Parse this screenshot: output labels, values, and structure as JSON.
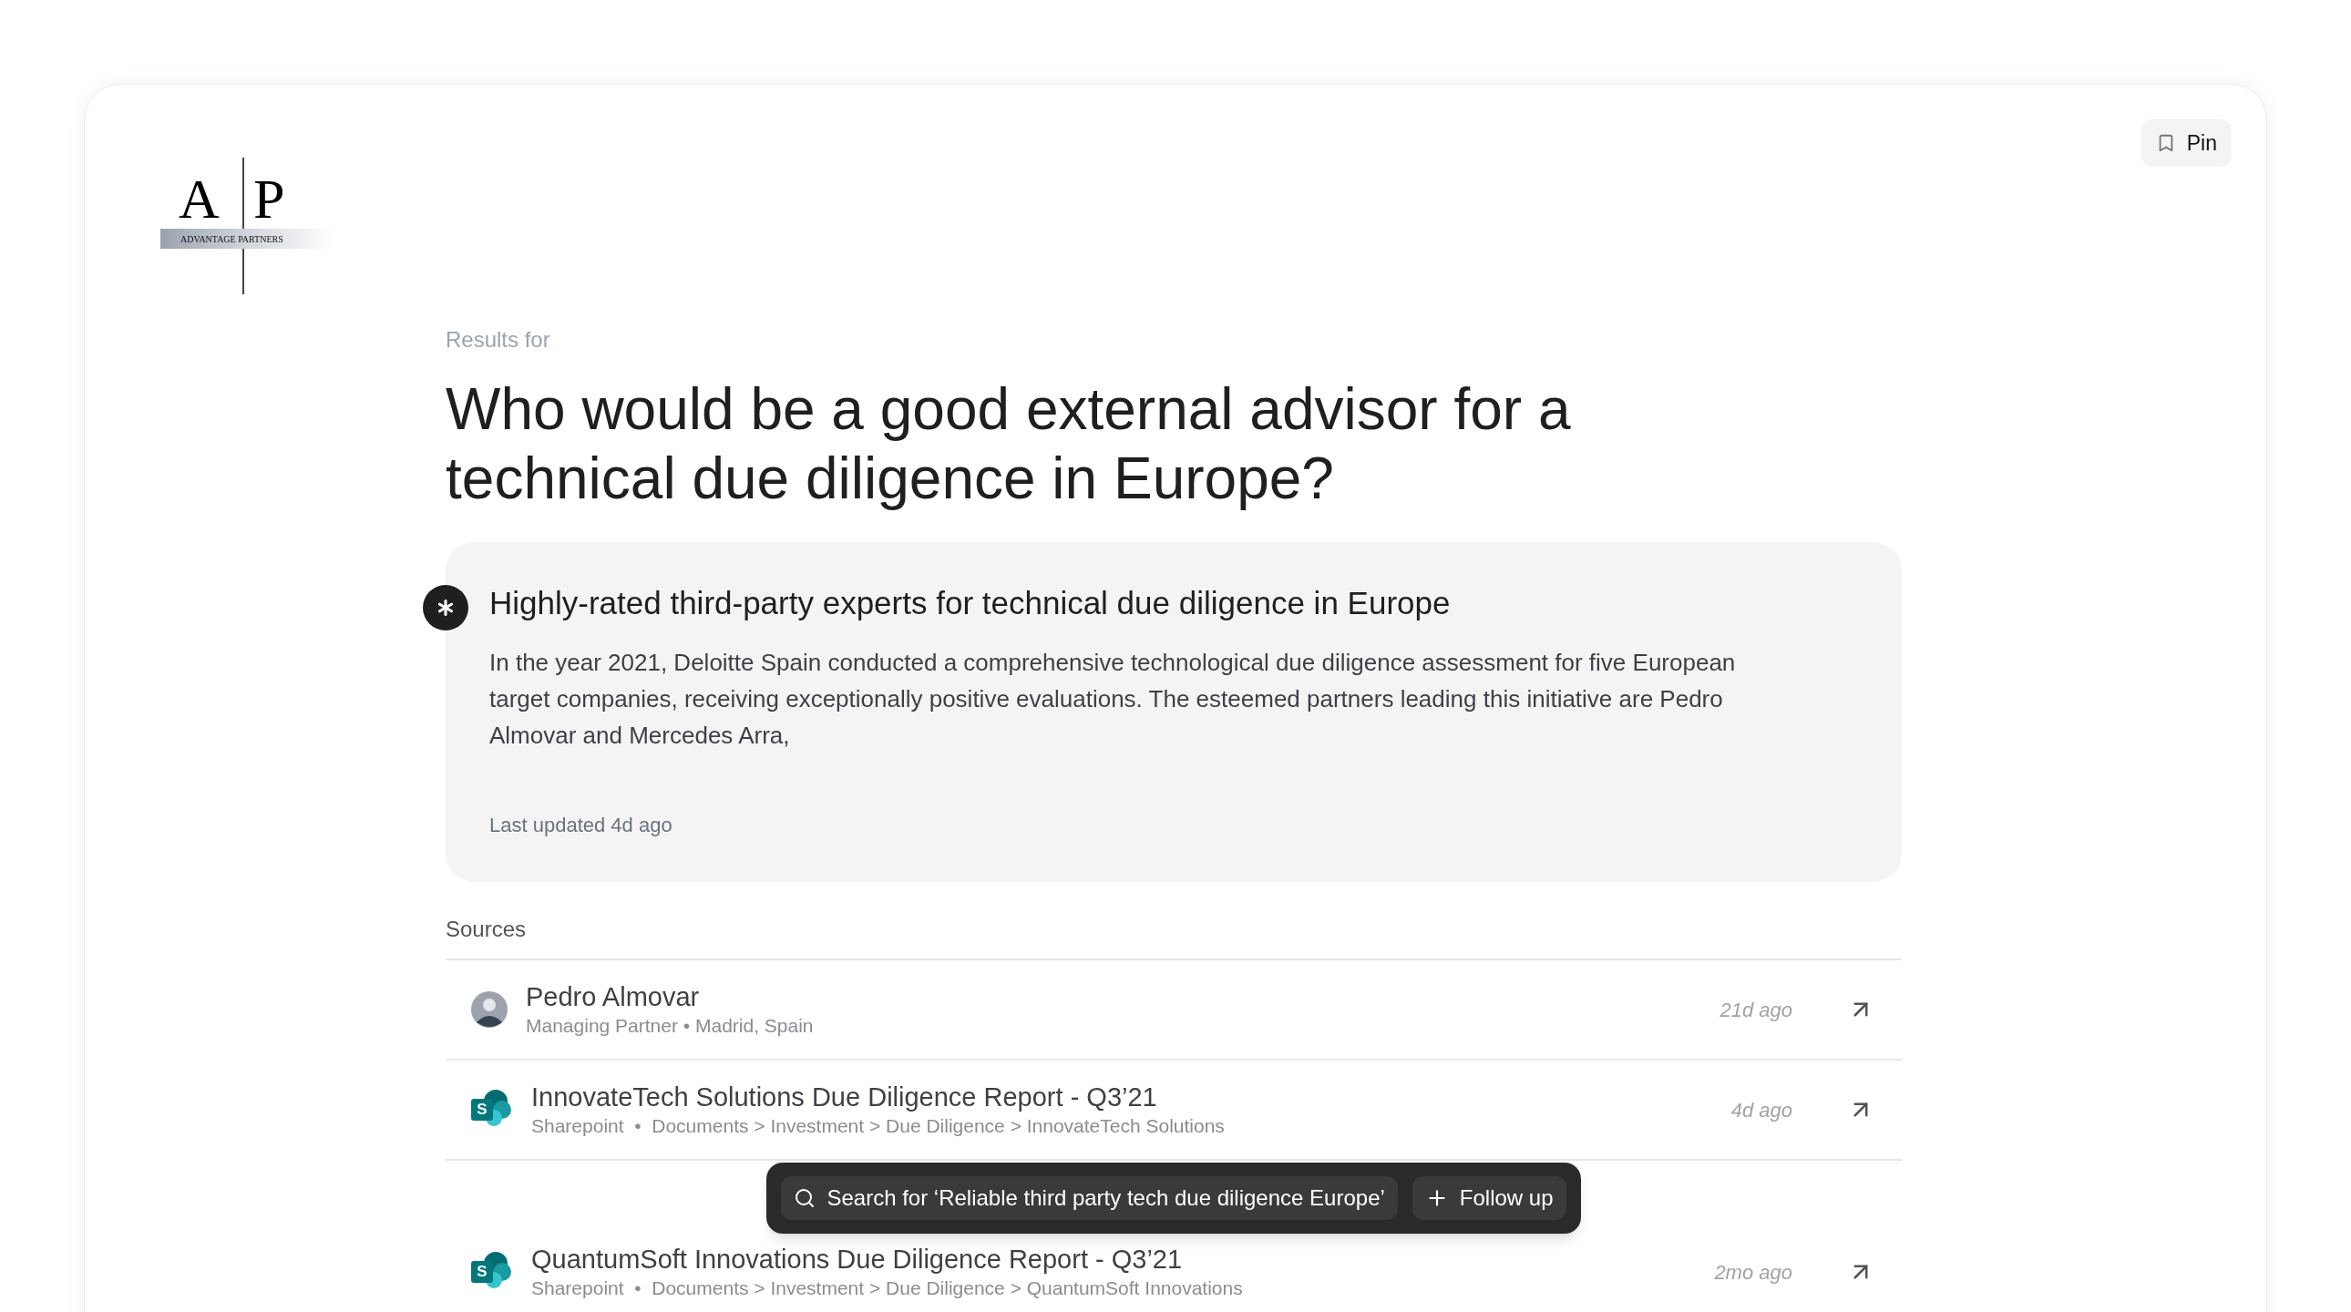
{
  "logo": {
    "letters": [
      "A",
      "P"
    ],
    "name": "ADVANTAGE PARTNERS"
  },
  "pin_button": {
    "label": "Pin"
  },
  "results_label": "Results for",
  "query": "Who would be a good external advisor for a technical due diligence in Europe?",
  "answer": {
    "title": "Highly-rated third-party experts for technical due diligence in Europe",
    "body": "In the year 2021, Deloitte Spain conducted a comprehensive technological due diligence assessment for five European target companies, receiving exceptionally positive evaluations. The esteemed partners leading this initiative are Pedro Almovar and Mercedes Arra,",
    "updated": "Last updated 4d ago"
  },
  "sources_label": "Sources",
  "sources": [
    {
      "kind": "person",
      "title": "Pedro Almovar",
      "subtitle": "Managing Partner • Madrid, Spain",
      "time": "21d ago"
    },
    {
      "kind": "sharepoint",
      "icon_letter": "S",
      "title": "InnovateTech Solutions Due Diligence Report - Q3’21",
      "subtitle": "Sharepoint  •  Documents > Investment > Due Diligence > InnovateTech Solutions",
      "time": "4d ago"
    },
    {
      "kind": "sharepoint",
      "icon_letter": "S",
      "title": "QuantumSoft Innovations Due Diligence Report - Q3’21",
      "subtitle": "Sharepoint  •  Documents > Investment > Due Diligence > QuantumSoft Innovations",
      "time": "2mo ago"
    }
  ],
  "action_bar": {
    "search": "Search for ‘Reliable third party tech due diligence Europe’",
    "follow_up": "Follow up"
  }
}
